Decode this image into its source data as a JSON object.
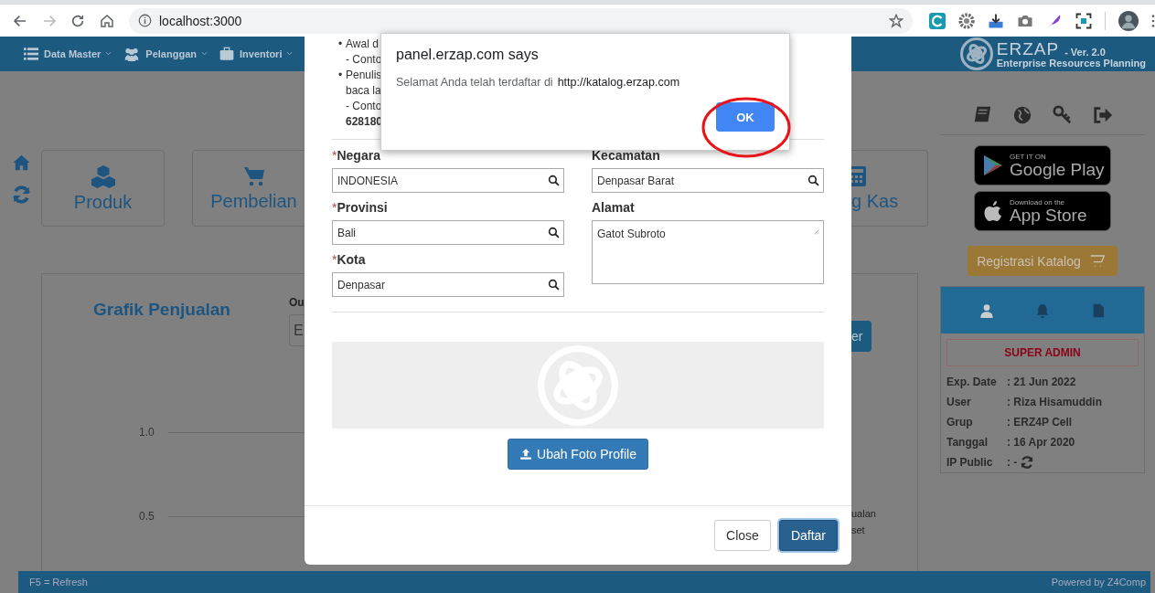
{
  "browser": {
    "url": "localhost:3000"
  },
  "navbar": {
    "menus": [
      {
        "label": "Data Master",
        "kind": "list"
      },
      {
        "label": "Pelanggan",
        "kind": "users"
      },
      {
        "label": "Inventori",
        "kind": "briefcase"
      }
    ],
    "brand": "ERZAP",
    "version": "- Ver. 2.0",
    "tagline": "Enterprise Resources Planning"
  },
  "shortcuts": [
    {
      "label": "Produk",
      "kind": "cubes"
    },
    {
      "label": "Pembelian",
      "kind": "cart"
    },
    {
      "label": "g Kas",
      "kind": "calculator"
    }
  ],
  "chart_panel": {
    "title": "Grafik Penjualan",
    "outlet_label": "Ou",
    "outlet_value": "E",
    "button": "er",
    "y_labels": [
      "1.0",
      "0.5"
    ],
    "legend": [
      "ualan",
      "set"
    ]
  },
  "sidebar": {
    "store_badges": [
      {
        "kind": "google",
        "small": "GET IT ON",
        "big": "Google Play"
      },
      {
        "kind": "apple",
        "small": "Download on the",
        "big": "App Store"
      }
    ],
    "catalog_button": "Registrasi Katalog",
    "role": "SUPER ADMIN",
    "info": [
      {
        "label": "Exp. Date",
        "value": ": 21 Jun 2022"
      },
      {
        "label": "User",
        "value": ": Riza Hisamuddin"
      },
      {
        "label": "Grup",
        "value": ": ERZ4P Cell"
      },
      {
        "label": "Tanggal",
        "value": ": 16 Apr 2020"
      },
      {
        "label": "IP Public",
        "value": ": -"
      }
    ]
  },
  "modal": {
    "notes": [
      {
        "bullet": "•",
        "lines": [
          {
            "text": "Awal d",
            "bold": false
          },
          {
            "text": "- Conto",
            "bold": false
          }
        ]
      },
      {
        "bullet": "•",
        "lines": [
          {
            "text": "Penulis",
            "bold": false
          },
          {
            "text": "baca la",
            "bold": false
          },
          {
            "text": "- Conto",
            "bold": false
          },
          {
            "text": "628180",
            "bold": true
          }
        ]
      }
    ],
    "left_fields": [
      {
        "required_mark": "*",
        "label": "Negara",
        "value": "INDONESIA",
        "kind": "lookup"
      },
      {
        "required_mark": "*",
        "label": "Provinsi",
        "value": "Bali",
        "kind": "lookup"
      },
      {
        "required_mark": "*",
        "label": "Kota",
        "value": "Denpasar",
        "kind": "lookup"
      }
    ],
    "right_fields": [
      {
        "label": "Kecamatan",
        "value": "Denpasar Barat",
        "kind": "lookup"
      },
      {
        "label": "Alamat",
        "value": "Gatot Subroto",
        "kind": "textarea"
      }
    ],
    "upload_button": "Ubah Foto Profile",
    "footer_buttons": [
      {
        "label": "Close",
        "primary": false
      },
      {
        "label": "Daftar",
        "primary": true
      }
    ]
  },
  "alert": {
    "title": "panel.erzap.com says",
    "message": "Selamat Anda telah terdaftar di",
    "link": "http://katalog.erzap.com",
    "button": "OK",
    "button_highlighted": true
  },
  "status_bar": {
    "left": "F5 = Refresh",
    "right": "Powered by Z4Comp"
  }
}
